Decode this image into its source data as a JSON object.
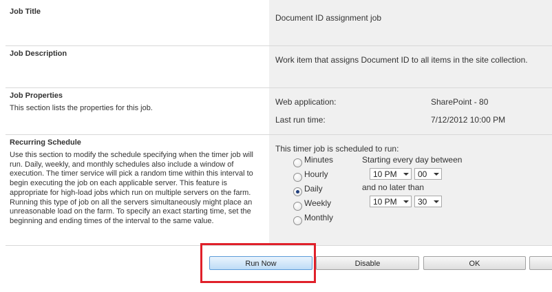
{
  "sections": {
    "job_title": {
      "title": "Job Title",
      "value": "Document ID assignment job"
    },
    "job_description": {
      "title": "Job Description",
      "value": "Work item that assigns Document ID to all items in the site collection."
    },
    "job_properties": {
      "title": "Job Properties",
      "description": "This section lists the properties for this job.",
      "web_application_label": "Web application:",
      "web_application_value": "SharePoint - 80",
      "last_run_label": "Last run time:",
      "last_run_value": "7/12/2012 10:00 PM"
    },
    "recurring_schedule": {
      "title": "Recurring Schedule",
      "description": "Use this section to modify the schedule specifying when the timer job will run. Daily, weekly, and monthly schedules also include a window of execution. The timer service will pick a random time within this interval to begin executing the job on each applicable server. This feature is appropriate for high-load jobs which run on multiple servers on the farm. Running this type of job on all the servers simultaneously might place an unreasonable load on the farm. To specify an exact starting time, set the beginning and ending times of the interval to the same value.",
      "intro": "This timer job is scheduled to run:",
      "options": [
        "Minutes",
        "Hourly",
        "Daily",
        "Weekly",
        "Monthly"
      ],
      "selected": "Daily",
      "start_label": "Starting every day between",
      "start_hour": "10 PM",
      "start_minute": "00",
      "end_label": "and no later than",
      "end_hour": "10 PM",
      "end_minute": "30"
    }
  },
  "buttons": {
    "run_now": "Run Now",
    "disable": "Disable",
    "ok": "OK"
  },
  "colors": {
    "highlight": "#e0202a",
    "primary_button": "#bedcf6",
    "right_panel": "#f0f0f0"
  }
}
